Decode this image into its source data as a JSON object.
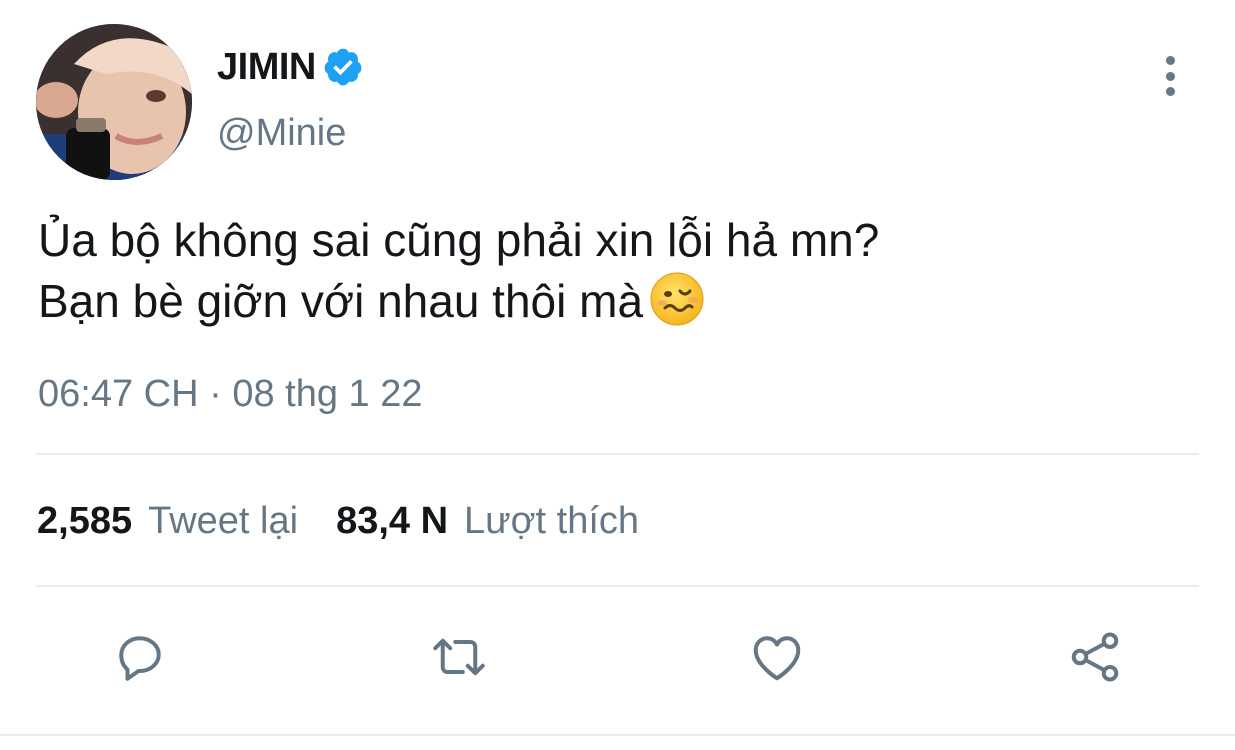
{
  "author": {
    "display_name": "JIMIN",
    "handle": "@Minie",
    "verified": true
  },
  "tweet": {
    "text_line_1": "Ủa bộ không sai cũng phải xin lỗi hả mn?",
    "text_line_2": "Bạn bè giỡn với nhau thôi mà",
    "emoji": "woozy-face",
    "time": "06:47 CH",
    "separator": "·",
    "date": "08 thg 1 22"
  },
  "stats": {
    "retweets_count": "2,585",
    "retweets_label": "Tweet lại",
    "likes_count": "83,4 N",
    "likes_label": "Lượt thích"
  },
  "actions": [
    "reply-icon",
    "retweet-icon",
    "like-icon",
    "share-icon"
  ],
  "colors": {
    "text": "#14171a",
    "secondary": "#657786",
    "verified_blue": "#1da1f2",
    "divider": "#e6ecf0"
  }
}
